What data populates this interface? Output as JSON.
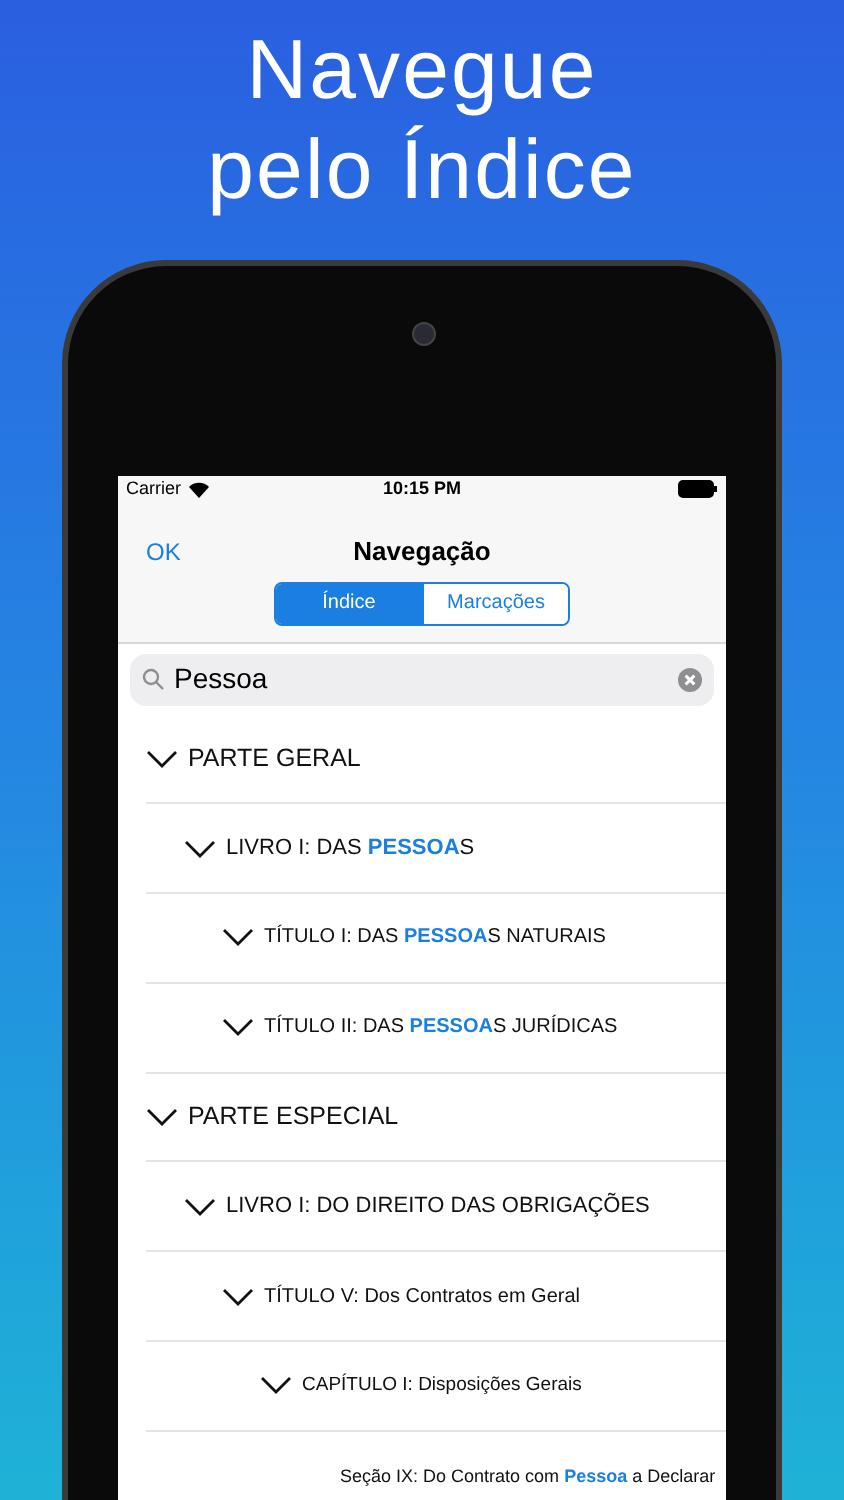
{
  "headline": [
    "Navegue",
    "pelo Índice"
  ],
  "status_bar": {
    "carrier": "Carrier",
    "time": "10:15 PM"
  },
  "nav": {
    "left_button": "OK",
    "title": "Navegação"
  },
  "segments": [
    {
      "label": "Índice",
      "selected": true
    },
    {
      "label": "Marcações",
      "selected": false
    }
  ],
  "search": {
    "value": "Pessoa"
  },
  "tree": [
    {
      "parts": [
        {
          "text": "PARTE GERAL",
          "highlight": false
        }
      ],
      "expanded": true,
      "children": [
        {
          "parts": [
            {
              "text": "LIVRO I: DAS ",
              "highlight": false
            },
            {
              "text": "PESSOA",
              "highlight": true
            },
            {
              "text": "S",
              "highlight": false
            }
          ],
          "expanded": true,
          "children": [
            {
              "parts": [
                {
                  "text": "TÍTULO I: DAS ",
                  "highlight": false
                },
                {
                  "text": "PESSOA",
                  "highlight": true
                },
                {
                  "text": "S NATURAIS",
                  "highlight": false
                }
              ],
              "expanded": true
            },
            {
              "parts": [
                {
                  "text": "TÍTULO II: DAS ",
                  "highlight": false
                },
                {
                  "text": "PESSOA",
                  "highlight": true
                },
                {
                  "text": "S JURÍDICAS",
                  "highlight": false
                }
              ],
              "expanded": true
            }
          ]
        }
      ]
    },
    {
      "parts": [
        {
          "text": "PARTE ESPECIAL",
          "highlight": false
        }
      ],
      "expanded": true,
      "children": [
        {
          "parts": [
            {
              "text": "LIVRO I: DO DIREITO DAS OBRIGAÇÕES",
              "highlight": false
            }
          ],
          "expanded": true,
          "children": [
            {
              "parts": [
                {
                  "text": "TÍTULO V: Dos Contratos em Geral",
                  "highlight": false
                }
              ],
              "expanded": true,
              "children": [
                {
                  "parts": [
                    {
                      "text": "CAPÍTULO I: Disposições Gerais",
                      "highlight": false
                    }
                  ],
                  "expanded": true,
                  "children": [
                    {
                      "parts": [
                        {
                          "text": "Seção IX: Do Contrato com ",
                          "highlight": false
                        },
                        {
                          "text": "Pessoa",
                          "highlight": true
                        },
                        {
                          "text": " a Declarar",
                          "highlight": false
                        }
                      ],
                      "kind": "leaf"
                    }
                  ]
                }
              ]
            }
          ]
        }
      ]
    }
  ]
}
